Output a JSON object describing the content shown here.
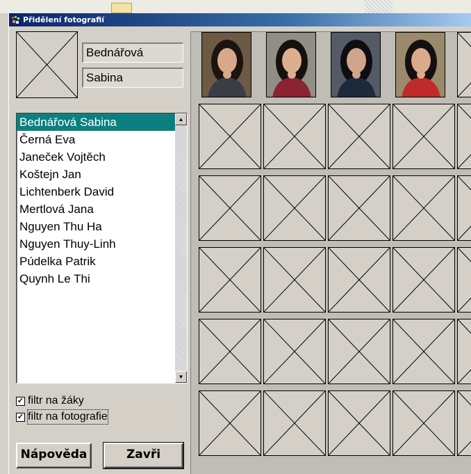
{
  "window": {
    "title": "Přidělení fotografií",
    "title_bar_color": "#0a246a"
  },
  "student": {
    "surname": "Bednářová",
    "first_name": "Sabina"
  },
  "students_list": {
    "items": [
      "Bednářová Sabina",
      "Černá Eva",
      "Janeček Vojtěch",
      "Koštejn Jan",
      "Lichtenberk David",
      "Mertlová Jana",
      "Nguyen Thu Ha",
      "Nguyen Thuy-Linh",
      "Púdelka Patrik",
      "Quynh Le Thi"
    ],
    "selected_index": 0,
    "selection_color": "#0c8080"
  },
  "filters": {
    "students_label": "filtr na žáky",
    "students_checked": true,
    "photos_label": "filtr na fotografie",
    "photos_checked": true,
    "check_mark": "✓"
  },
  "buttons": {
    "help_label": "Nápověda",
    "close_label": "Zavři"
  },
  "photos": {
    "thumbnails": [
      {
        "name": "photo-1",
        "bg": "#6d5a45",
        "hair": "#1b1411",
        "skin": "#d7a98a",
        "shirt": "#3a3d46"
      },
      {
        "name": "photo-2",
        "bg": "#8f8f86",
        "hair": "#16110e",
        "skin": "#dcb08f",
        "shirt": "#8a2430"
      },
      {
        "name": "photo-3",
        "bg": "#545a66",
        "hair": "#0e0d10",
        "skin": "#cfa58c",
        "shirt": "#1d2a3c"
      },
      {
        "name": "photo-4",
        "bg": "#9a8a6b",
        "hair": "#141012",
        "skin": "#dba98c",
        "shirt": "#c02a2a"
      }
    ],
    "placeholder_rows": 5
  }
}
